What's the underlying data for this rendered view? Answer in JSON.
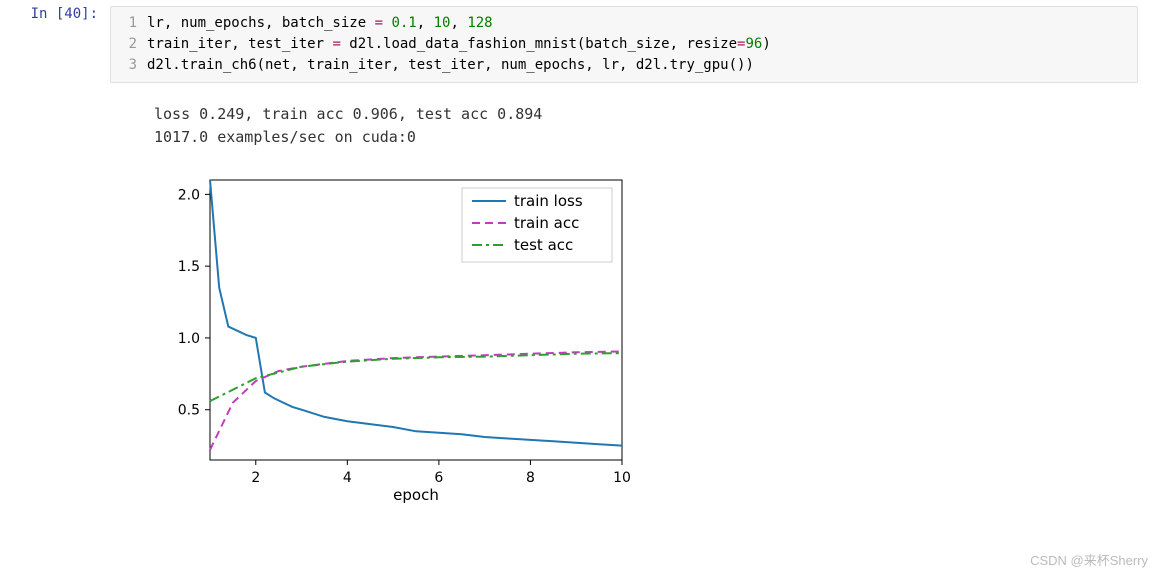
{
  "prompt": {
    "label": "In [40]:"
  },
  "code": {
    "lines": [
      {
        "n": "1",
        "html": "lr, num_epochs, batch_size <span class='tok-op'>=</span> <span class='tok-num'>0.1</span>, <span class='tok-num'>10</span>, <span class='tok-num'>128</span>"
      },
      {
        "n": "2",
        "html": "train_iter, test_iter <span class='tok-op'>=</span> d2l.load_data_fashion_mnist(batch_size, resize<span class='tok-op'>=</span><span class='tok-num'>96</span>)"
      },
      {
        "n": "3",
        "html": "d2l.train_ch6(net, train_iter, test_iter, num_epochs, lr, d2l.try_gpu())"
      }
    ]
  },
  "output": {
    "line1": "loss 0.249, train acc 0.906, test acc 0.894",
    "line2": "1017.0 examples/sec on cuda:0"
  },
  "chart_data": {
    "type": "line",
    "xlabel": "epoch",
    "ylabel": "",
    "xlim": [
      1,
      10
    ],
    "ylim": [
      0.15,
      2.1
    ],
    "xticks": [
      2,
      4,
      6,
      8,
      10
    ],
    "yticks": [
      0.5,
      1.0,
      1.5,
      2.0
    ],
    "series": [
      {
        "name": "train loss",
        "style": "solid",
        "color": "#1f77b4",
        "x": [
          1.0,
          1.2,
          1.4,
          1.6,
          1.8,
          2.0,
          2.2,
          2.4,
          2.6,
          2.8,
          3.0,
          3.5,
          4.0,
          4.5,
          5.0,
          5.5,
          6.0,
          6.5,
          7.0,
          7.5,
          8.0,
          8.5,
          9.0,
          9.5,
          10.0
        ],
        "y": [
          2.1,
          1.35,
          1.08,
          1.05,
          1.02,
          1.0,
          0.62,
          0.58,
          0.55,
          0.52,
          0.5,
          0.45,
          0.42,
          0.4,
          0.38,
          0.35,
          0.34,
          0.33,
          0.31,
          0.3,
          0.29,
          0.28,
          0.27,
          0.26,
          0.25
        ]
      },
      {
        "name": "train acc",
        "style": "dashed",
        "color": "#c13cc1",
        "x": [
          1.0,
          1.5,
          2.0,
          2.5,
          3.0,
          3.5,
          4.0,
          4.5,
          5.0,
          5.5,
          6.0,
          6.5,
          7.0,
          7.5,
          8.0,
          8.5,
          9.0,
          9.5,
          10.0
        ],
        "y": [
          0.22,
          0.55,
          0.7,
          0.77,
          0.8,
          0.82,
          0.84,
          0.85,
          0.86,
          0.865,
          0.87,
          0.875,
          0.88,
          0.885,
          0.89,
          0.895,
          0.9,
          0.903,
          0.906
        ]
      },
      {
        "name": "test acc",
        "style": "dashdot",
        "color": "#2ca02c",
        "x": [
          1.0,
          2.0,
          3.0,
          4.0,
          5.0,
          6.0,
          7.0,
          8.0,
          9.0,
          10.0
        ],
        "y": [
          0.56,
          0.72,
          0.8,
          0.835,
          0.855,
          0.865,
          0.87,
          0.88,
          0.89,
          0.894
        ]
      }
    ],
    "legend": {
      "position": "upper-right",
      "entries": [
        "train loss",
        "train acc",
        "test acc"
      ]
    }
  },
  "watermark": "CSDN @来杯Sherry"
}
